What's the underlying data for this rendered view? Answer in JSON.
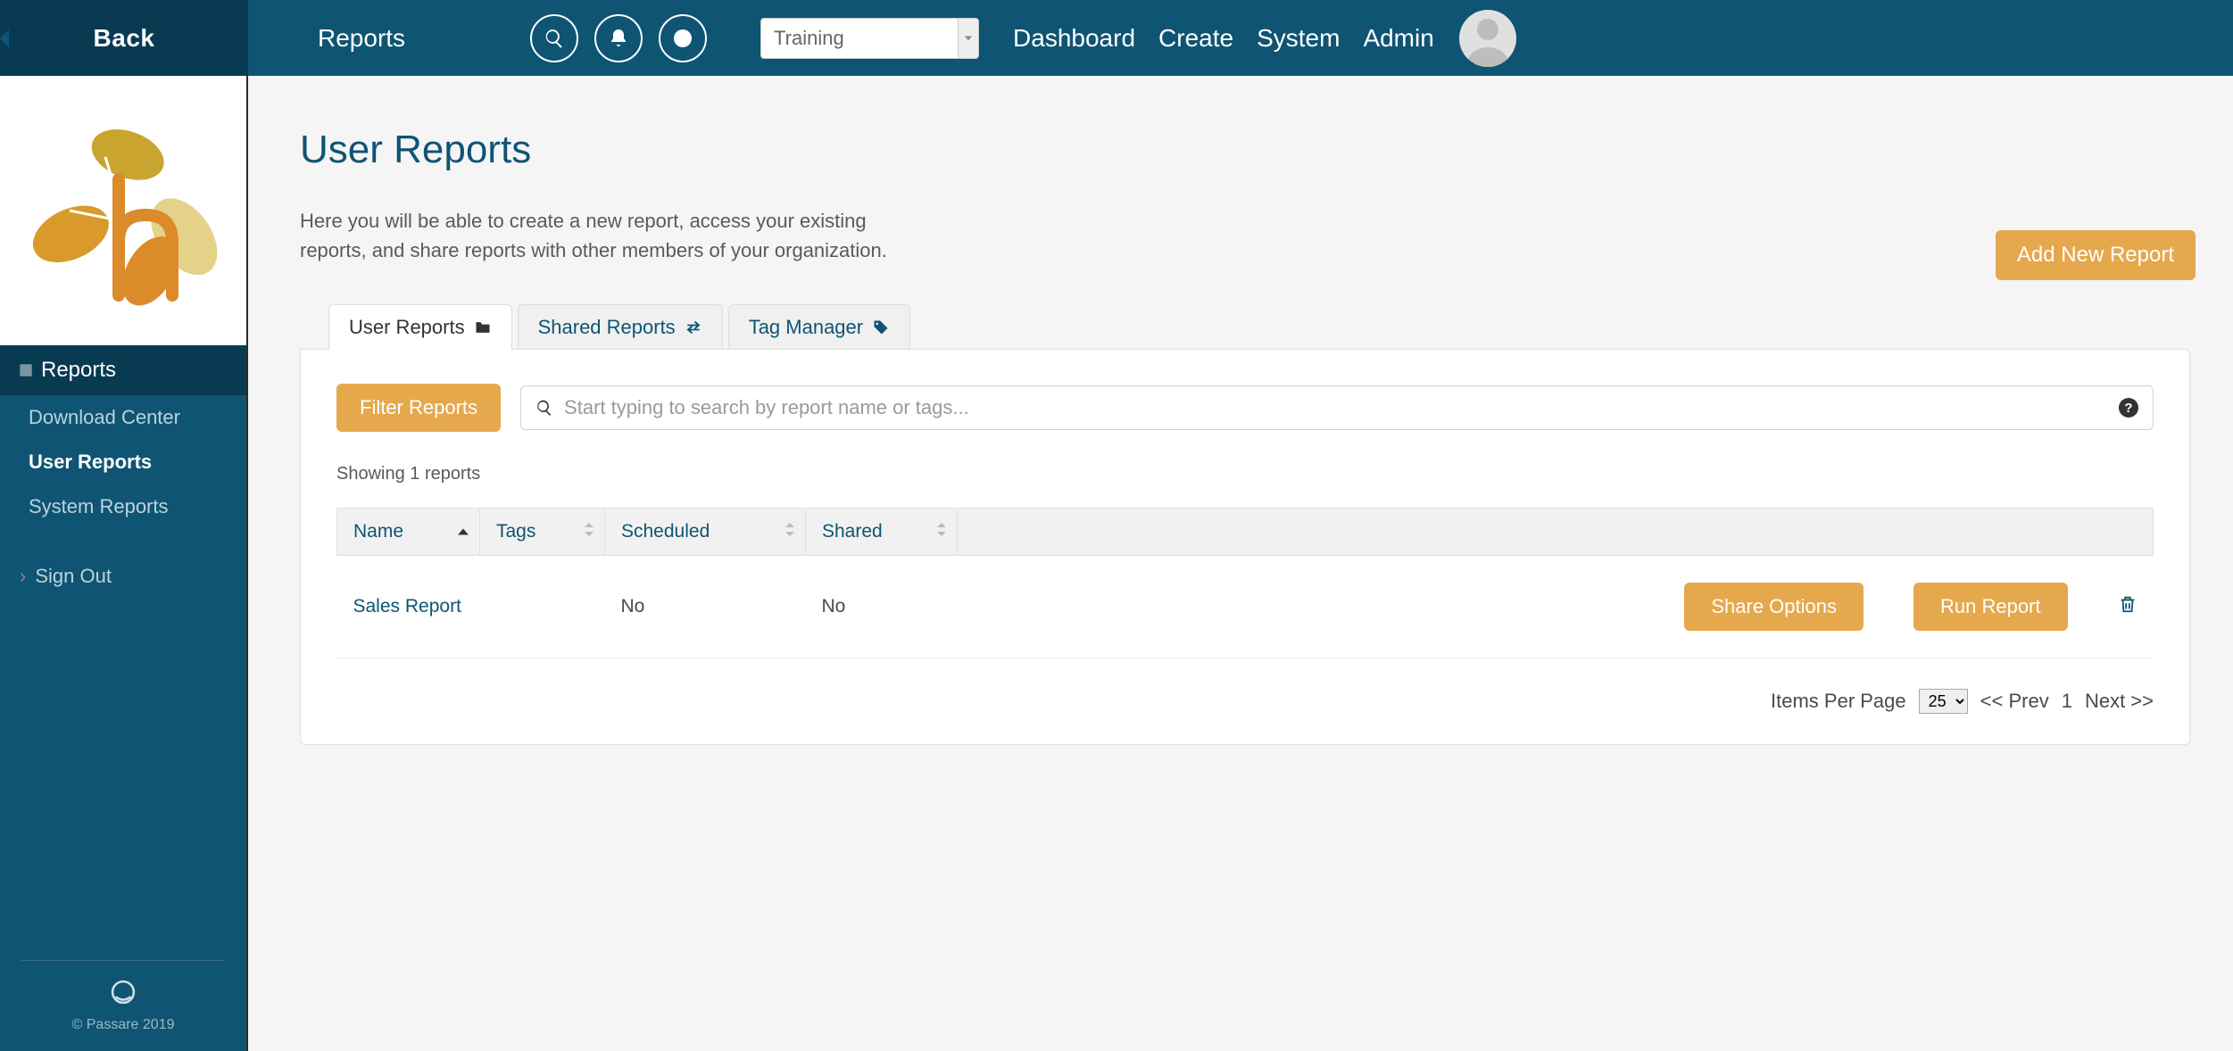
{
  "header": {
    "back": "Back",
    "section": "Reports",
    "env": "Training",
    "nav": {
      "dashboard": "Dashboard",
      "create": "Create",
      "system": "System",
      "admin": "Admin"
    }
  },
  "sidebar": {
    "section_label": "Reports",
    "items": {
      "download_center": "Download Center",
      "user_reports": "User Reports",
      "system_reports": "System Reports"
    },
    "signout": "Sign Out",
    "footer": "© Passare 2019"
  },
  "page": {
    "title": "User Reports",
    "desc": "Here you will be able to create a new report, access your existing reports, and share reports with other members of your organization.",
    "add_new": "Add New Report"
  },
  "tabs": {
    "user": "User Reports",
    "shared": "Shared Reports",
    "tags": "Tag Manager"
  },
  "filter": {
    "button": "Filter Reports",
    "placeholder": "Start typing to search by report name or tags..."
  },
  "showing": "Showing 1 reports",
  "columns": {
    "name": "Name",
    "tags": "Tags",
    "scheduled": "Scheduled",
    "shared": "Shared"
  },
  "rows": [
    {
      "name": "Sales Report",
      "tags": "",
      "scheduled": "No",
      "shared": "No"
    }
  ],
  "row_actions": {
    "share": "Share Options",
    "run": "Run Report"
  },
  "pager": {
    "label": "Items Per Page",
    "per_page": "25",
    "prev": "<< Prev",
    "current": "1",
    "next": "Next >>"
  }
}
